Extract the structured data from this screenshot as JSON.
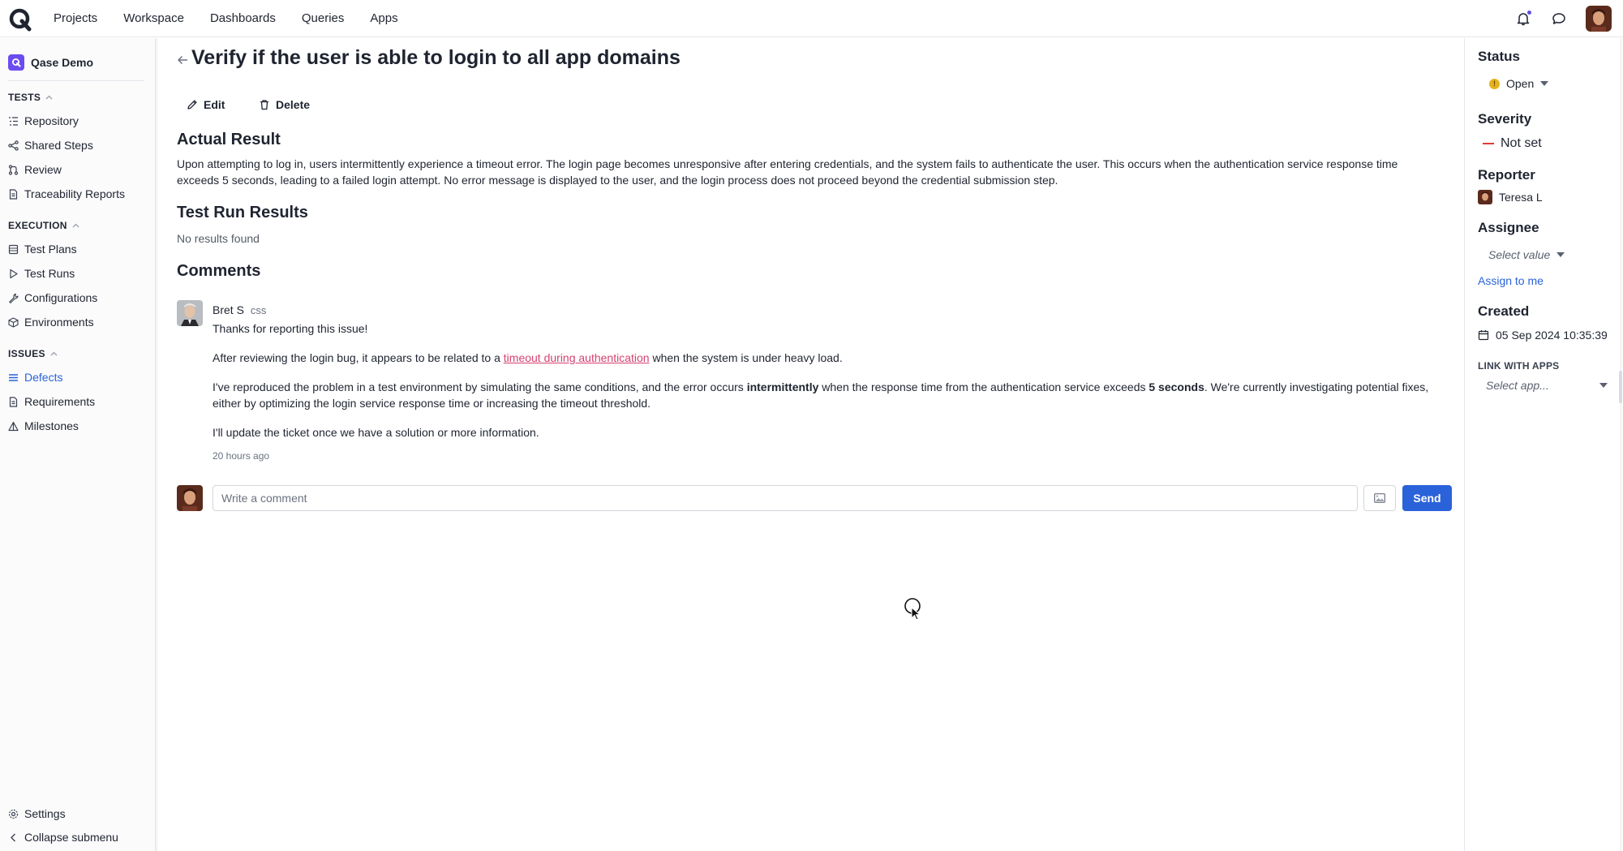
{
  "topnav": {
    "items": [
      "Projects",
      "Workspace",
      "Dashboards",
      "Queries",
      "Apps"
    ],
    "accent": "#5b4ee5"
  },
  "sidebar": {
    "project_name": "Qase Demo",
    "sections": [
      {
        "title": "TESTS",
        "items": [
          {
            "label": "Repository",
            "icon": "list-tree-icon"
          },
          {
            "label": "Shared Steps",
            "icon": "share-nodes-icon"
          },
          {
            "label": "Review",
            "icon": "merge-icon"
          },
          {
            "label": "Traceability Reports",
            "icon": "document-icon"
          }
        ]
      },
      {
        "title": "EXECUTION",
        "items": [
          {
            "label": "Test Plans",
            "icon": "table-icon"
          },
          {
            "label": "Test Runs",
            "icon": "play-icon"
          },
          {
            "label": "Configurations",
            "icon": "wrench-icon"
          },
          {
            "label": "Environments",
            "icon": "cube-icon"
          }
        ]
      },
      {
        "title": "ISSUES",
        "items": [
          {
            "label": "Defects",
            "icon": "defects-icon",
            "active": true
          },
          {
            "label": "Requirements",
            "icon": "document-icon"
          },
          {
            "label": "Milestones",
            "icon": "triangle-icon"
          }
        ]
      }
    ],
    "settings_label": "Settings",
    "collapse_label": "Collapse submenu",
    "active_color": "#2a62d9"
  },
  "main": {
    "title": "Verify if the user is able to login to all app domains",
    "edit_label": "Edit",
    "delete_label": "Delete",
    "actual_result_heading": "Actual Result",
    "actual_result_text": "Upon attempting to log in, users intermittently experience a timeout error. The login page becomes unresponsive after entering credentials, and the system fails to authenticate the user. This occurs when the authentication service response time exceeds 5 seconds, leading to a failed login attempt. No error message is displayed to the user, and the login process does not proceed beyond the credential submission step.",
    "test_run_heading": "Test Run Results",
    "test_run_empty": "No results found",
    "comments_heading": "Comments",
    "comment": {
      "author": "Bret S",
      "author_tag": "css",
      "greeting": "Thanks for reporting this issue!",
      "p1_before": "After reviewing the login bug, it appears to be related to a ",
      "p1_link": "timeout during authentication",
      "p1_after": " when the system is under heavy load.",
      "p2_a": "I've reproduced the problem in a test environment by simulating the same conditions, and the error occurs ",
      "p2_bold1": "intermittently",
      "p2_b": " when the response time from the authentication service exceeds ",
      "p2_bold2": "5 seconds",
      "p2_c": ". We're currently investigating potential fixes, either by optimizing the login service response time or increasing the timeout threshold.",
      "p3": "I'll update the ticket once we have a solution or more information.",
      "time": "20 hours ago"
    },
    "comment_input_placeholder": "Write a comment",
    "send_label": "Send"
  },
  "details": {
    "status_label": "Status",
    "status_value": "Open",
    "status_color": "#e5b21d",
    "severity_label": "Severity",
    "severity_value": "Not set",
    "severity_color": "#e03a3a",
    "reporter_label": "Reporter",
    "reporter_value": "Teresa L",
    "assignee_label": "Assignee",
    "assignee_placeholder": "Select value",
    "assign_to_me": "Assign to me",
    "created_label": "Created",
    "created_value": "05 Sep 2024 10:35:39",
    "link_apps_label": "LINK WITH APPS",
    "link_apps_placeholder": "Select app..."
  }
}
